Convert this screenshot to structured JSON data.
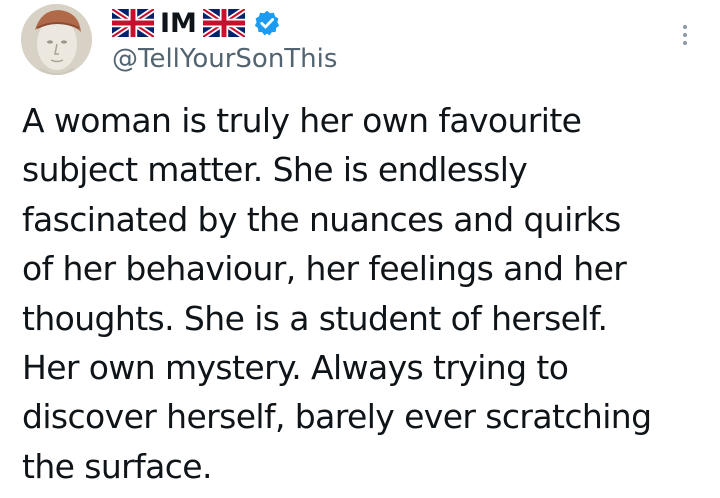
{
  "author": {
    "display_name": "IM",
    "handle": "@TellYourSonThis",
    "verified": true,
    "flag_icon": "uk-flag-icon",
    "avatar_icon": "statue-bust-avatar"
  },
  "tweet": {
    "text": "A woman is truly her own favourite\nsubject matter. She is endlessly\nfascinated by the nuances and quirks\nof her behaviour, her feelings and her\nthoughts. She is a student of herself.\nHer own mystery. Always trying to\ndiscover herself, barely ever scratching\nthe surface."
  },
  "colors": {
    "text": "#0f1419",
    "secondary": "#536471",
    "verified_badge": "#1d9bf0",
    "more_dots": "#8b98a5"
  }
}
